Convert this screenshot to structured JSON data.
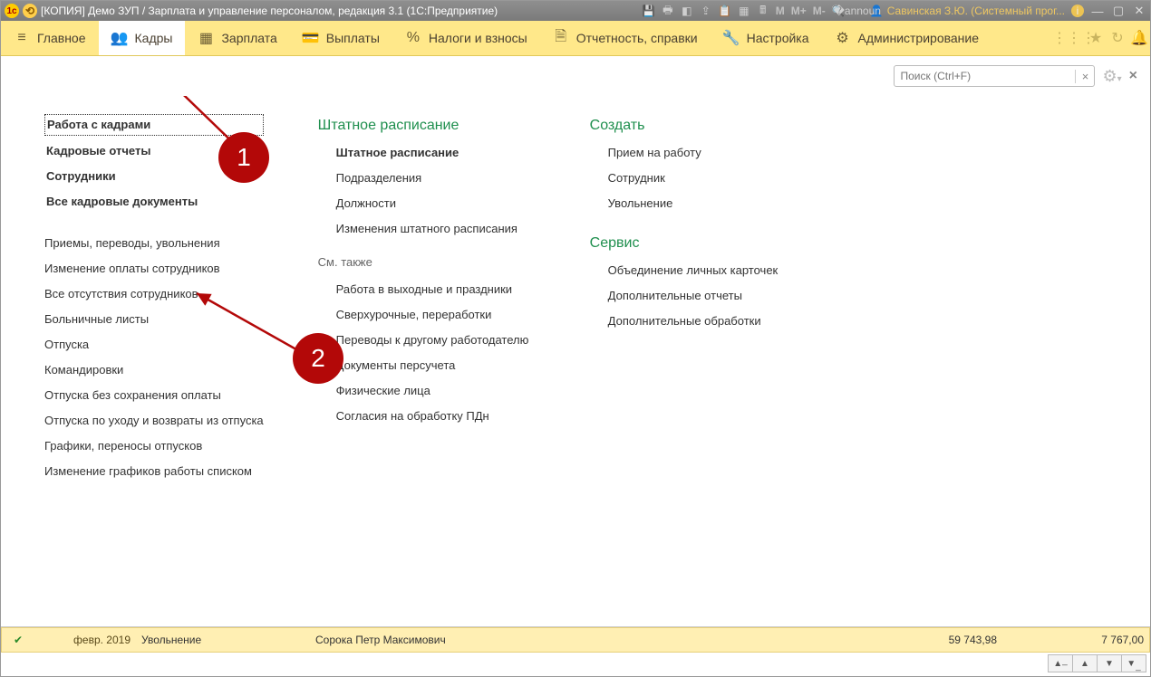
{
  "title": "[КОПИЯ] Демо ЗУП / Зарплата и управление персоналом, редакция 3.1  (1С:Предприятие)",
  "user": "Савинская З.Ю. (Системный прог...",
  "calc_buttons": [
    "M",
    "M+",
    "M-"
  ],
  "menu": [
    {
      "label": "Главное",
      "icon": "≡"
    },
    {
      "label": "Кадры",
      "icon": "👥",
      "active": true
    },
    {
      "label": "Зарплата",
      "icon": "▦"
    },
    {
      "label": "Выплаты",
      "icon": "💳"
    },
    {
      "label": "Налоги и взносы",
      "icon": "%"
    },
    {
      "label": "Отчетность, справки",
      "icon": "🗎"
    },
    {
      "label": "Настройка",
      "icon": "🔧"
    },
    {
      "label": "Администрирование",
      "icon": "⚙"
    }
  ],
  "search_placeholder": "Поиск (Ctrl+F)",
  "col1": {
    "top": [
      "Работа с кадрами",
      "Кадровые отчеты",
      "Сотрудники",
      "Все кадровые документы"
    ],
    "mid": [
      "Приемы, переводы, увольнения",
      "Изменение оплаты сотрудников",
      "Все отсутствия сотрудников",
      "Больничные листы",
      "Отпуска",
      "Командировки",
      "Отпуска без сохранения оплаты",
      "Отпуска по уходу и возвраты из отпуска",
      "Графики, переносы отпусков",
      "Изменение графиков работы списком"
    ]
  },
  "col2": {
    "header": "Штатное расписание",
    "items": [
      "Штатное расписание",
      "Подразделения",
      "Должности",
      "Изменения штатного расписания"
    ],
    "see_also_label": "См. также",
    "see_also": [
      "Работа в выходные и праздники",
      "Сверхурочные, переработки",
      "Переводы к другому работодателю",
      "Документы персучета",
      "Физические лица",
      "Согласия на обработку ПДн"
    ]
  },
  "col3": {
    "create_header": "Создать",
    "create": [
      "Прием на работу",
      "Сотрудник",
      "Увольнение"
    ],
    "service_header": "Сервис",
    "service": [
      "Объединение личных карточек",
      "Дополнительные отчеты",
      "Дополнительные обработки"
    ]
  },
  "bottom_row": {
    "period": "февр. 2019",
    "doctype": "Увольнение",
    "person": "Сорока Петр Максимович",
    "sum1": "59 743,98",
    "sum2": "7 767,00"
  },
  "annotations": {
    "a1": "1",
    "a2": "2"
  }
}
